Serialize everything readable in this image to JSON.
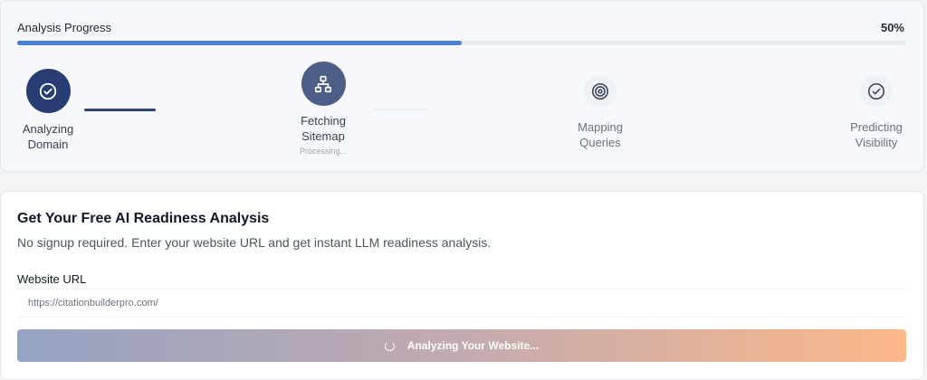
{
  "progress": {
    "label": "Analysis Progress",
    "percent_text": "50%",
    "value": 0.5
  },
  "steps": [
    {
      "label_line1": "Analyzing",
      "label_line2": "Domain",
      "icon": "check-circle-icon",
      "state": "completed"
    },
    {
      "label_line1": "Fetching",
      "label_line2": "Sitemap",
      "sub": "Processing...",
      "icon": "sitemap-icon",
      "state": "active"
    },
    {
      "label_line1": "Mapping",
      "label_line2": "Queries",
      "icon": "target-icon",
      "state": "pending"
    },
    {
      "label_line1": "Predicting",
      "label_line2": "Visibility",
      "icon": "check-circle-icon",
      "state": "pending"
    }
  ],
  "form": {
    "title": "Get Your Free AI Readiness Analysis",
    "subtitle": "No signup required. Enter your website URL and get instant LLM readiness analysis.",
    "url_label": "Website URL",
    "url_value": "https://citationbuilderpro.com/",
    "button_label": "Analyzing Your Website..."
  },
  "colors": {
    "accent": "#4a7fd8",
    "step_completed": "#273d73",
    "step_active": "#4f5e86",
    "step_pending_bg": "#eef1f5",
    "button_gradient_start": "#95a3c2",
    "button_gradient_end": "#fcb889"
  }
}
